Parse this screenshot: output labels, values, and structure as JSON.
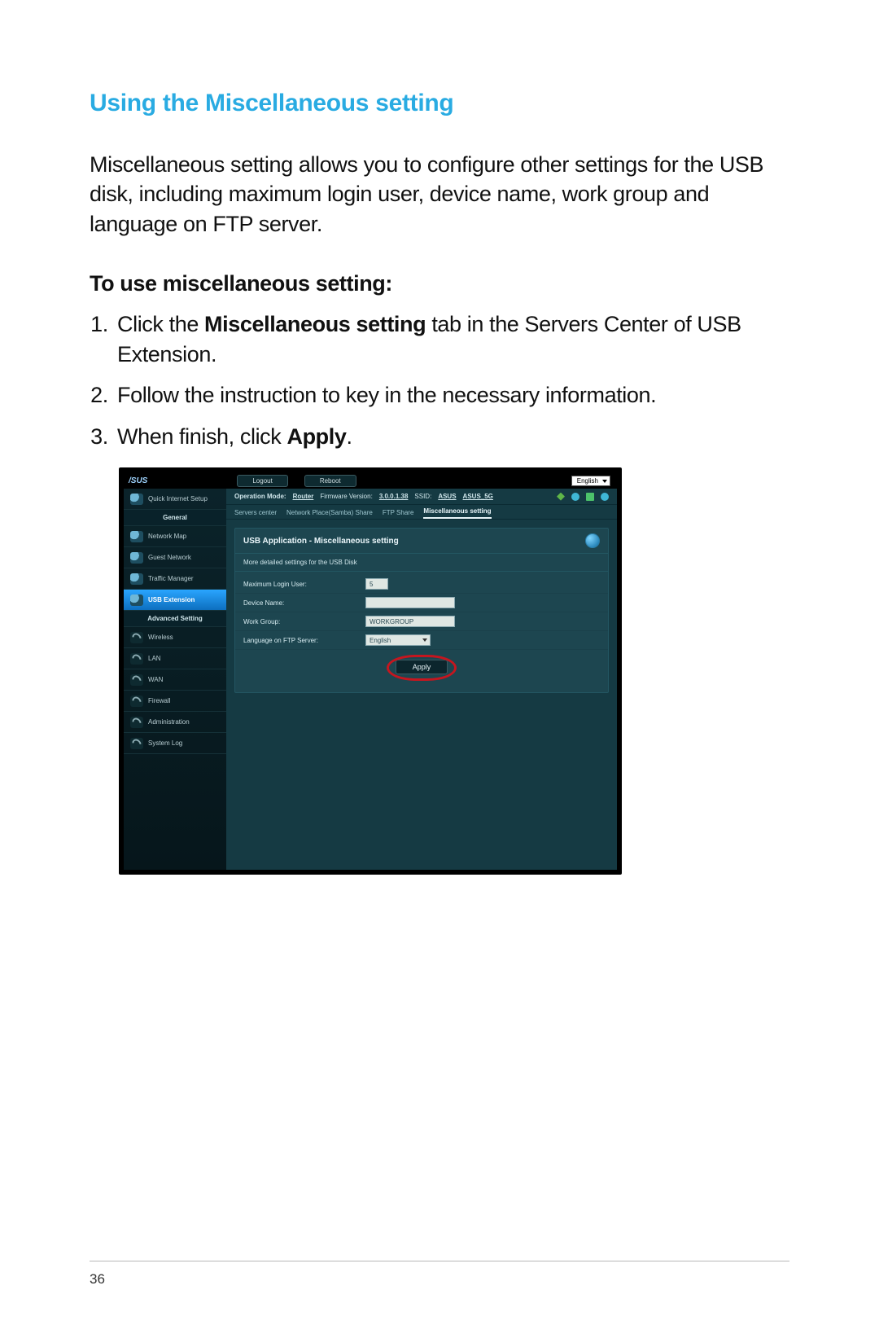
{
  "page": {
    "title": "Using the Miscellaneous setting",
    "intro": "Miscellaneous setting allows you to configure other settings for the USB disk, including maximum login user, device name, work group and language on FTP server.",
    "sub_heading": "To use miscellaneous setting:",
    "number": "36"
  },
  "steps": {
    "s1_a": "Click the ",
    "s1_b": "Miscellaneous setting",
    "s1_c": " tab in the Servers Center of USB Extension.",
    "s2": "Follow the instruction to key in the necessary information.",
    "s3_a": "When finish, click ",
    "s3_b": "Apply",
    "s3_c": "."
  },
  "shot": {
    "logo": "/SUS",
    "logout": "Logout",
    "reboot": "Reboot",
    "language": "English",
    "status": {
      "op_mode_label": "Operation Mode:",
      "op_mode_value": "Router",
      "fw_label": "Firmware Version:",
      "fw_value": "3.0.0.1.38",
      "ssid_label": "SSID:",
      "ssid1": "ASUS",
      "ssid2": "ASUS_5G"
    },
    "tabs": {
      "t1": "Servers center",
      "t2": "Network Place(Samba) Share",
      "t3": "FTP Share",
      "t4": "Miscellaneous setting"
    },
    "card": {
      "title": "USB Application - Miscellaneous setting",
      "subtitle": "More detailed settings for the USB Disk"
    },
    "form": {
      "max_login_label": "Maximum Login User:",
      "max_login_value": "5",
      "device_name_label": "Device Name:",
      "device_name_value": "",
      "workgroup_label": "Work Group:",
      "workgroup_value": "WORKGROUP",
      "ftp_lang_label": "Language on FTP Server:",
      "ftp_lang_value": "English",
      "apply": "Apply"
    },
    "sidebar": {
      "quick": "Quick Internet Setup",
      "general": "General",
      "items_general": [
        "Network Map",
        "Guest Network",
        "Traffic Manager",
        "USB Extension"
      ],
      "advanced": "Advanced Setting",
      "items_adv": [
        "Wireless",
        "LAN",
        "WAN",
        "Firewall",
        "Administration",
        "System Log"
      ]
    }
  }
}
